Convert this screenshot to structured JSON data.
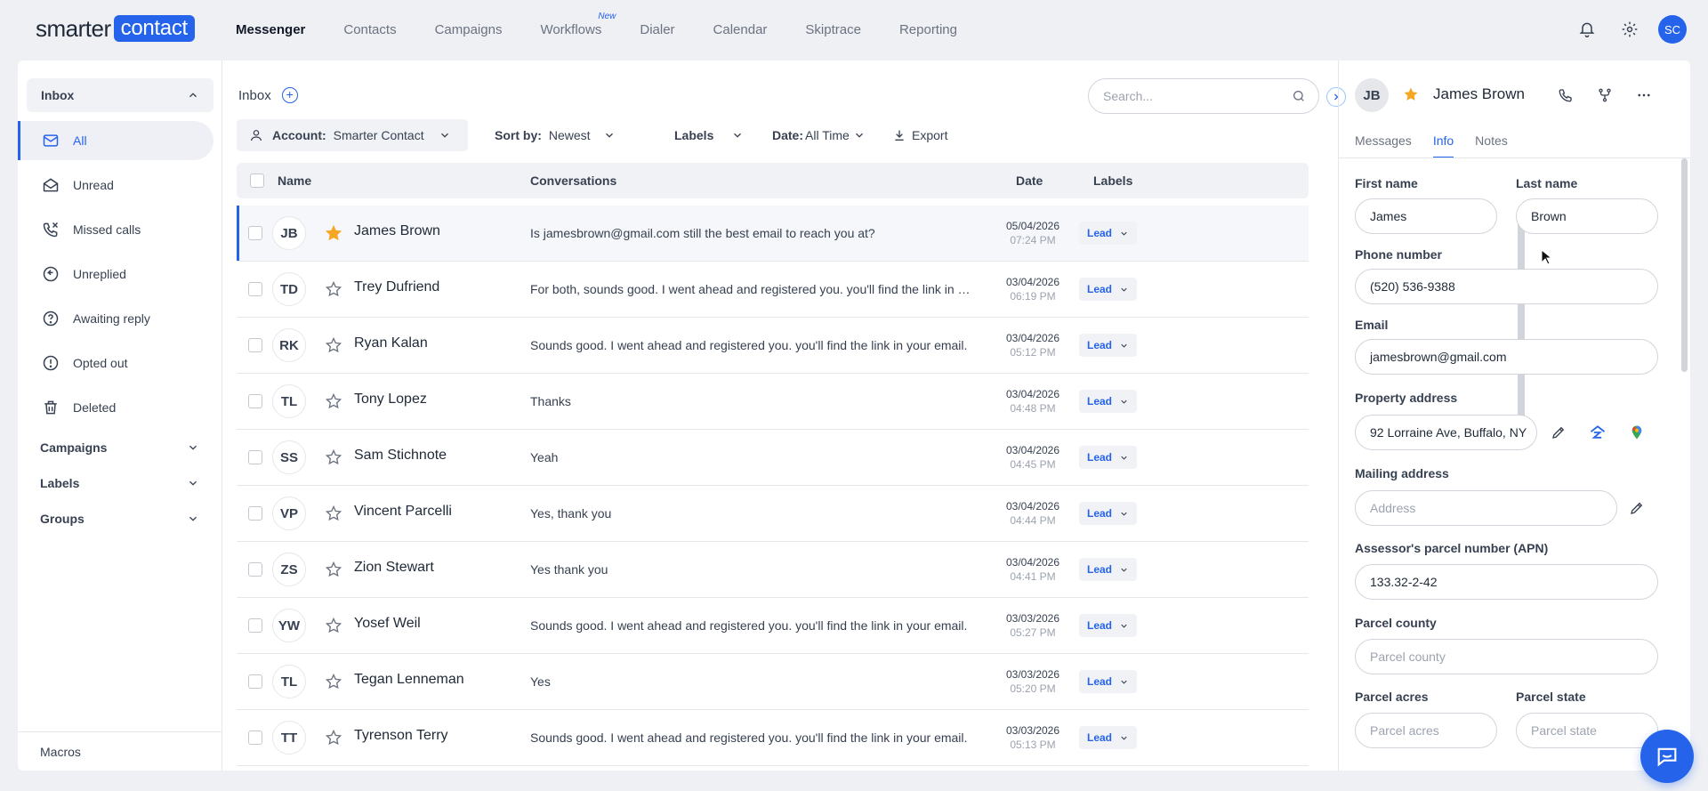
{
  "brand": {
    "part1": "smarter",
    "part2": "contact"
  },
  "nav": {
    "items": [
      {
        "label": "Messenger",
        "active": true
      },
      {
        "label": "Contacts"
      },
      {
        "label": "Campaigns"
      },
      {
        "label": "Workflows",
        "badge": "New"
      },
      {
        "label": "Dialer"
      },
      {
        "label": "Calendar"
      },
      {
        "label": "Skiptrace"
      },
      {
        "label": "Reporting"
      }
    ],
    "user_initials": "SC"
  },
  "sidebar": {
    "inbox_label": "Inbox",
    "items": [
      {
        "label": "All",
        "icon": "mail-icon"
      },
      {
        "label": "Unread",
        "icon": "envelope-open-icon"
      },
      {
        "label": "Missed calls",
        "icon": "missed-call-icon"
      },
      {
        "label": "Unreplied",
        "icon": "unreplied-icon"
      },
      {
        "label": "Awaiting reply",
        "icon": "question-icon"
      },
      {
        "label": "Opted out",
        "icon": "alert-icon"
      },
      {
        "label": "Deleted",
        "icon": "trash-icon"
      }
    ],
    "sections": [
      {
        "label": "Campaigns"
      },
      {
        "label": "Labels"
      },
      {
        "label": "Groups"
      }
    ],
    "macros_label": "Macros"
  },
  "inbox": {
    "title": "Inbox",
    "search_placeholder": "Search...",
    "filters": {
      "account_label": "Account:",
      "account_value": "Smarter Contact",
      "sort_label": "Sort by:",
      "sort_value": "Newest",
      "labels_label": "Labels",
      "date_label": "Date:",
      "date_value": "All Time",
      "export_label": "Export"
    },
    "columns": {
      "name": "Name",
      "conversations": "Conversations",
      "date": "Date",
      "labels": "Labels"
    },
    "rows": [
      {
        "initials": "JB",
        "name": "James Brown",
        "starred": true,
        "message": "Is jamesbrown@gmail.com still the best email to reach you at?",
        "date": "05/04/2026",
        "time": "07:24 PM",
        "label": "Lead"
      },
      {
        "initials": "TD",
        "name": "Trey Dufriend",
        "starred": false,
        "message": "For both, sounds good. I went ahead and registered you. you'll find the link in your email.",
        "date": "03/04/2026",
        "time": "06:19 PM",
        "label": "Lead"
      },
      {
        "initials": "RK",
        "name": "Ryan Kalan",
        "starred": false,
        "message": "Sounds good. I went ahead and registered you. you'll find the link in your email.",
        "date": "03/04/2026",
        "time": "05:12 PM",
        "label": "Lead"
      },
      {
        "initials": "TL",
        "name": "Tony Lopez",
        "starred": false,
        "message": "Thanks",
        "date": "03/04/2026",
        "time": "04:48 PM",
        "label": "Lead"
      },
      {
        "initials": "SS",
        "name": "Sam Stichnote",
        "starred": false,
        "message": "Yeah",
        "date": "03/04/2026",
        "time": "04:45 PM",
        "label": "Lead"
      },
      {
        "initials": "VP",
        "name": "Vincent Parcelli",
        "starred": false,
        "message": "Yes, thank you",
        "date": "03/04/2026",
        "time": "04:44 PM",
        "label": "Lead"
      },
      {
        "initials": "ZS",
        "name": "Zion Stewart",
        "starred": false,
        "message": "Yes thank you",
        "date": "03/04/2026",
        "time": "04:41 PM",
        "label": "Lead"
      },
      {
        "initials": "YW",
        "name": "Yosef Weil",
        "starred": false,
        "message": "Sounds good. I went ahead and registered you. you'll find the link in your email.",
        "date": "03/03/2026",
        "time": "05:27 PM",
        "label": "Lead"
      },
      {
        "initials": "TL",
        "name": "Tegan Lenneman",
        "starred": false,
        "message": "Yes",
        "date": "03/03/2026",
        "time": "05:20 PM",
        "label": "Lead"
      },
      {
        "initials": "TT",
        "name": "Tyrenson Terry",
        "starred": false,
        "message": "Sounds good. I went ahead and registered you. you'll find the link in your email.",
        "date": "03/03/2026",
        "time": "05:13 PM",
        "label": "Lead"
      }
    ]
  },
  "contact": {
    "initials": "JB",
    "name": "James Brown",
    "tabs": [
      "Messages",
      "Info",
      "Notes"
    ],
    "fields": {
      "first_name_label": "First name",
      "first_name": "James",
      "last_name_label": "Last name",
      "last_name": "Brown",
      "phone_label": "Phone number",
      "phone": "(520) 536-9388",
      "email_label": "Email",
      "email": "jamesbrown@gmail.com",
      "property_label": "Property address",
      "property": "92 Lorraine Ave, Buffalo, NY",
      "mailing_label": "Mailing address",
      "mailing_placeholder": "Address",
      "apn_label": "Assessor's parcel number (APN)",
      "apn": "133.32-2-42",
      "county_label": "Parcel county",
      "county_placeholder": "Parcel county",
      "acres_label": "Parcel acres",
      "acres_placeholder": "Parcel acres",
      "state_label": "Parcel state",
      "state_placeholder": "Parcel state"
    }
  },
  "colors": {
    "accent": "#2563eb",
    "star": "#f5a623"
  }
}
